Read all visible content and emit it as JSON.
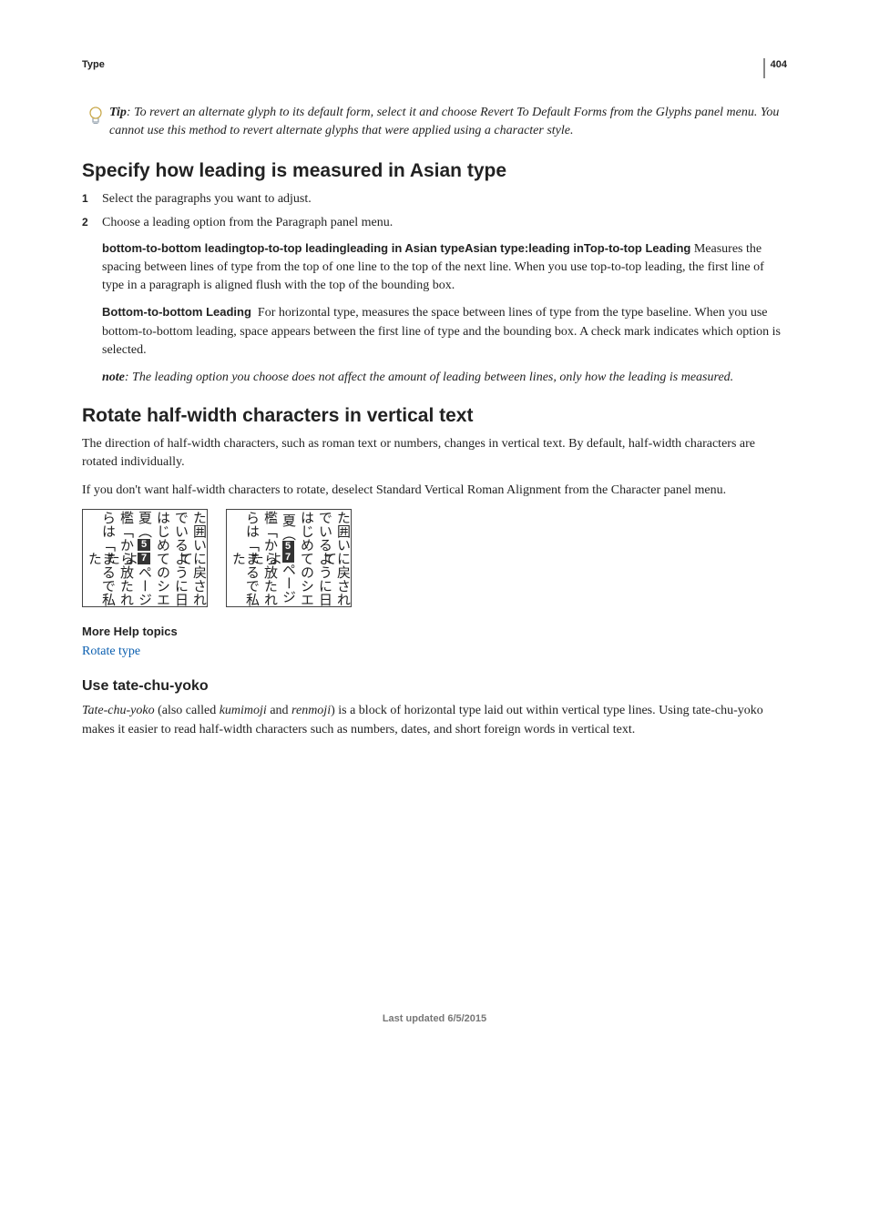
{
  "header": {
    "section": "Type",
    "page_number": "404"
  },
  "tip": {
    "label": "Tip",
    "text": ": To revert an alternate glyph to its default form, select it and choose Revert To Default Forms from the Glyphs panel menu. You cannot use this method to revert alternate glyphs that were applied using a character style."
  },
  "s1": {
    "heading": "Specify how leading is measured in Asian type",
    "step1": "Select the paragraphs you want to adjust.",
    "step2": "Choose a leading option from the Paragraph panel menu.",
    "block1_runin": "bottom-to-bottom leadingtop-to-top leadingleading in Asian typeAsian type:leading inTop-to-top Leading",
    "block1_body": "Measures the spacing between lines of type from the top of one line to the top of the next line. When you use top-to-top leading, the first line of type in a paragraph is aligned flush with the top of the bounding box.",
    "block2_runin": "Bottom-to-bottom Leading",
    "block2_body": "For horizontal type, measures the space between lines of type from the type baseline. When you use bottom-to-bottom leading, space appears between the first line of type and the bounding box. A check mark indicates which option is selected.",
    "note_label": "note",
    "note_text": ": The leading option you choose does not affect the amount of leading between lines, only how the leading is measured."
  },
  "s2": {
    "heading": "Rotate half-width characters in vertical text",
    "p1": "The direction of half-width characters, such as roman text or numbers, changes in vertical text. By default, half-width characters are rotated individually.",
    "p2": "If you don't want half-width characters to rotate, deselect Standard Vertical Roman Alignment from the Character panel menu.",
    "fig": {
      "col1": "た囲いに戻されて",
      "col2": "でいるように日",
      "col3": "はじめてのシエ",
      "col4": "夏︵",
      "col4_tail": "ページよ",
      "col5": "檻﹁から放たれた",
      "col6": "らは﹁まるで私た",
      "num_a": "5",
      "num_b": "7"
    },
    "more_help": "More Help topics",
    "link": "Rotate type"
  },
  "s3": {
    "heading": "Use tate-chu-yoko",
    "p1_a": "Tate-chu-yoko",
    "p1_b": " (also called ",
    "p1_c": "kumimoji",
    "p1_d": " and ",
    "p1_e": "renmoji",
    "p1_f": ") is a block of horizontal type laid out within vertical type lines. Using tate-chu-yoko makes it easier to read half-width characters such as numbers, dates, and short foreign words in vertical text."
  },
  "footer": "Last updated 6/5/2015"
}
